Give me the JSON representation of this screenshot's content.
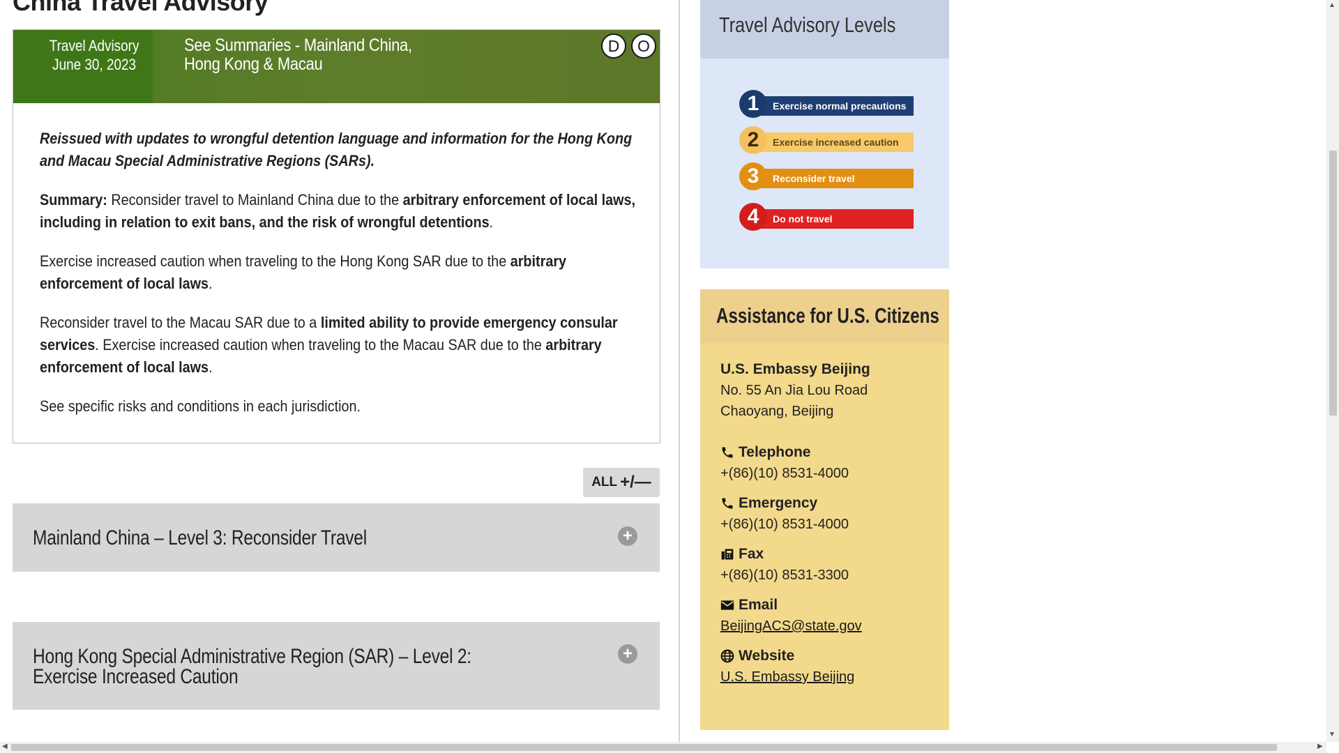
{
  "page": {
    "title": "China Travel Advisory"
  },
  "advisory": {
    "date_label": "Travel Advisory",
    "date": "June 30, 2023",
    "summary_link": "See Summaries - Mainland China, Hong Kong & Macau",
    "badges": [
      "D",
      "O"
    ],
    "reissued": "Reissued with updates to wrongful detention language and information for the Hong Kong and Macau Special Administrative Regions (SARs).",
    "p1": {
      "lead": "Summary:",
      "text1": " Reconsider travel to Mainland China due to the ",
      "bold1": "arbitrary enforcement of local laws, including in relation to exit bans, and the risk of wrongful detentions",
      "text2": "."
    },
    "p2": {
      "text1": "Exercise increased caution when traveling to the Hong Kong SAR due to the ",
      "bold1": "arbitrary enforcement of local laws",
      "text2": "."
    },
    "p3": {
      "text1": "Reconsider travel to the Macau SAR due to a ",
      "bold1": "limited ability to provide emergency consular services",
      "text2": ". Exercise increased caution when traveling to the Macau SAR due to the ",
      "bold2": "arbitrary enforcement of local laws",
      "text3": "."
    },
    "p4": "See specific risks and conditions in each jurisdiction."
  },
  "expand_all": {
    "label": "ALL",
    "symbol": "+/—"
  },
  "accordions": [
    {
      "title": "Mainland China – Level 3: Reconsider Travel"
    },
    {
      "title": "Hong Kong Special Administrative Region (SAR) – Level 2: Exercise Increased Caution"
    }
  ],
  "levels": {
    "title": "Travel Advisory Levels",
    "items": [
      {
        "num": "1",
        "label": "Exercise normal precautions",
        "color": "#1f3e73"
      },
      {
        "num": "2",
        "label": "Exercise increased caution",
        "color": "#f7c969"
      },
      {
        "num": "3",
        "label": "Reconsider travel",
        "color": "#e38f12"
      },
      {
        "num": "4",
        "label": "Do not travel",
        "color": "#e02121"
      }
    ]
  },
  "assistance": {
    "title": "Assistance for U.S. Citizens",
    "embassy": "U.S. Embassy Beijing",
    "address1": "No. 55 An Jia Lou Road",
    "address2": "Chaoyang, Beijing",
    "telephone_label": "Telephone",
    "telephone": "+(86)(10) 8531-4000",
    "emergency_label": "Emergency",
    "emergency": "+(86)(10) 8531-4000",
    "fax_label": "Fax",
    "fax": "+(86)(10) 8531-3300",
    "email_label": "Email",
    "email": "BeijingACS@state.gov",
    "website_label": "Website",
    "website": "U.S. Embassy Beijing"
  },
  "icons": {
    "phone": "phone-icon",
    "fax": "fax-icon",
    "email": "envelope-icon",
    "website": "globe-icon",
    "plus": "plus-circle-icon"
  }
}
